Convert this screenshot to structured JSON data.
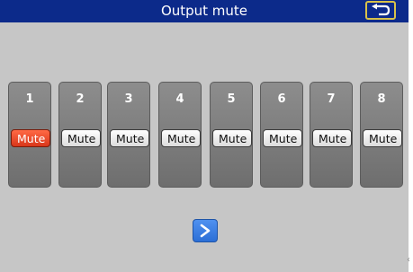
{
  "header": {
    "title": "Output mute",
    "back_icon": "return-arrow-icon"
  },
  "channels": [
    {
      "number": "1",
      "mute_label": "Mute",
      "muted": true
    },
    {
      "number": "2",
      "mute_label": "Mute",
      "muted": false
    },
    {
      "number": "3",
      "mute_label": "Mute",
      "muted": false
    },
    {
      "number": "4",
      "mute_label": "Mute",
      "muted": false
    },
    {
      "number": "5",
      "mute_label": "Mute",
      "muted": false
    },
    {
      "number": "6",
      "mute_label": "Mute",
      "muted": false
    },
    {
      "number": "7",
      "mute_label": "Mute",
      "muted": false
    },
    {
      "number": "8",
      "mute_label": "Mute",
      "muted": false
    }
  ],
  "footer": {
    "next_icon": "chevron-right-icon"
  },
  "colors": {
    "title_bar": "#0c2a8a",
    "background": "#c6c6c6",
    "mute_active": "#e04020",
    "next_button": "#3a7fe4",
    "back_border": "#d8c24a"
  }
}
